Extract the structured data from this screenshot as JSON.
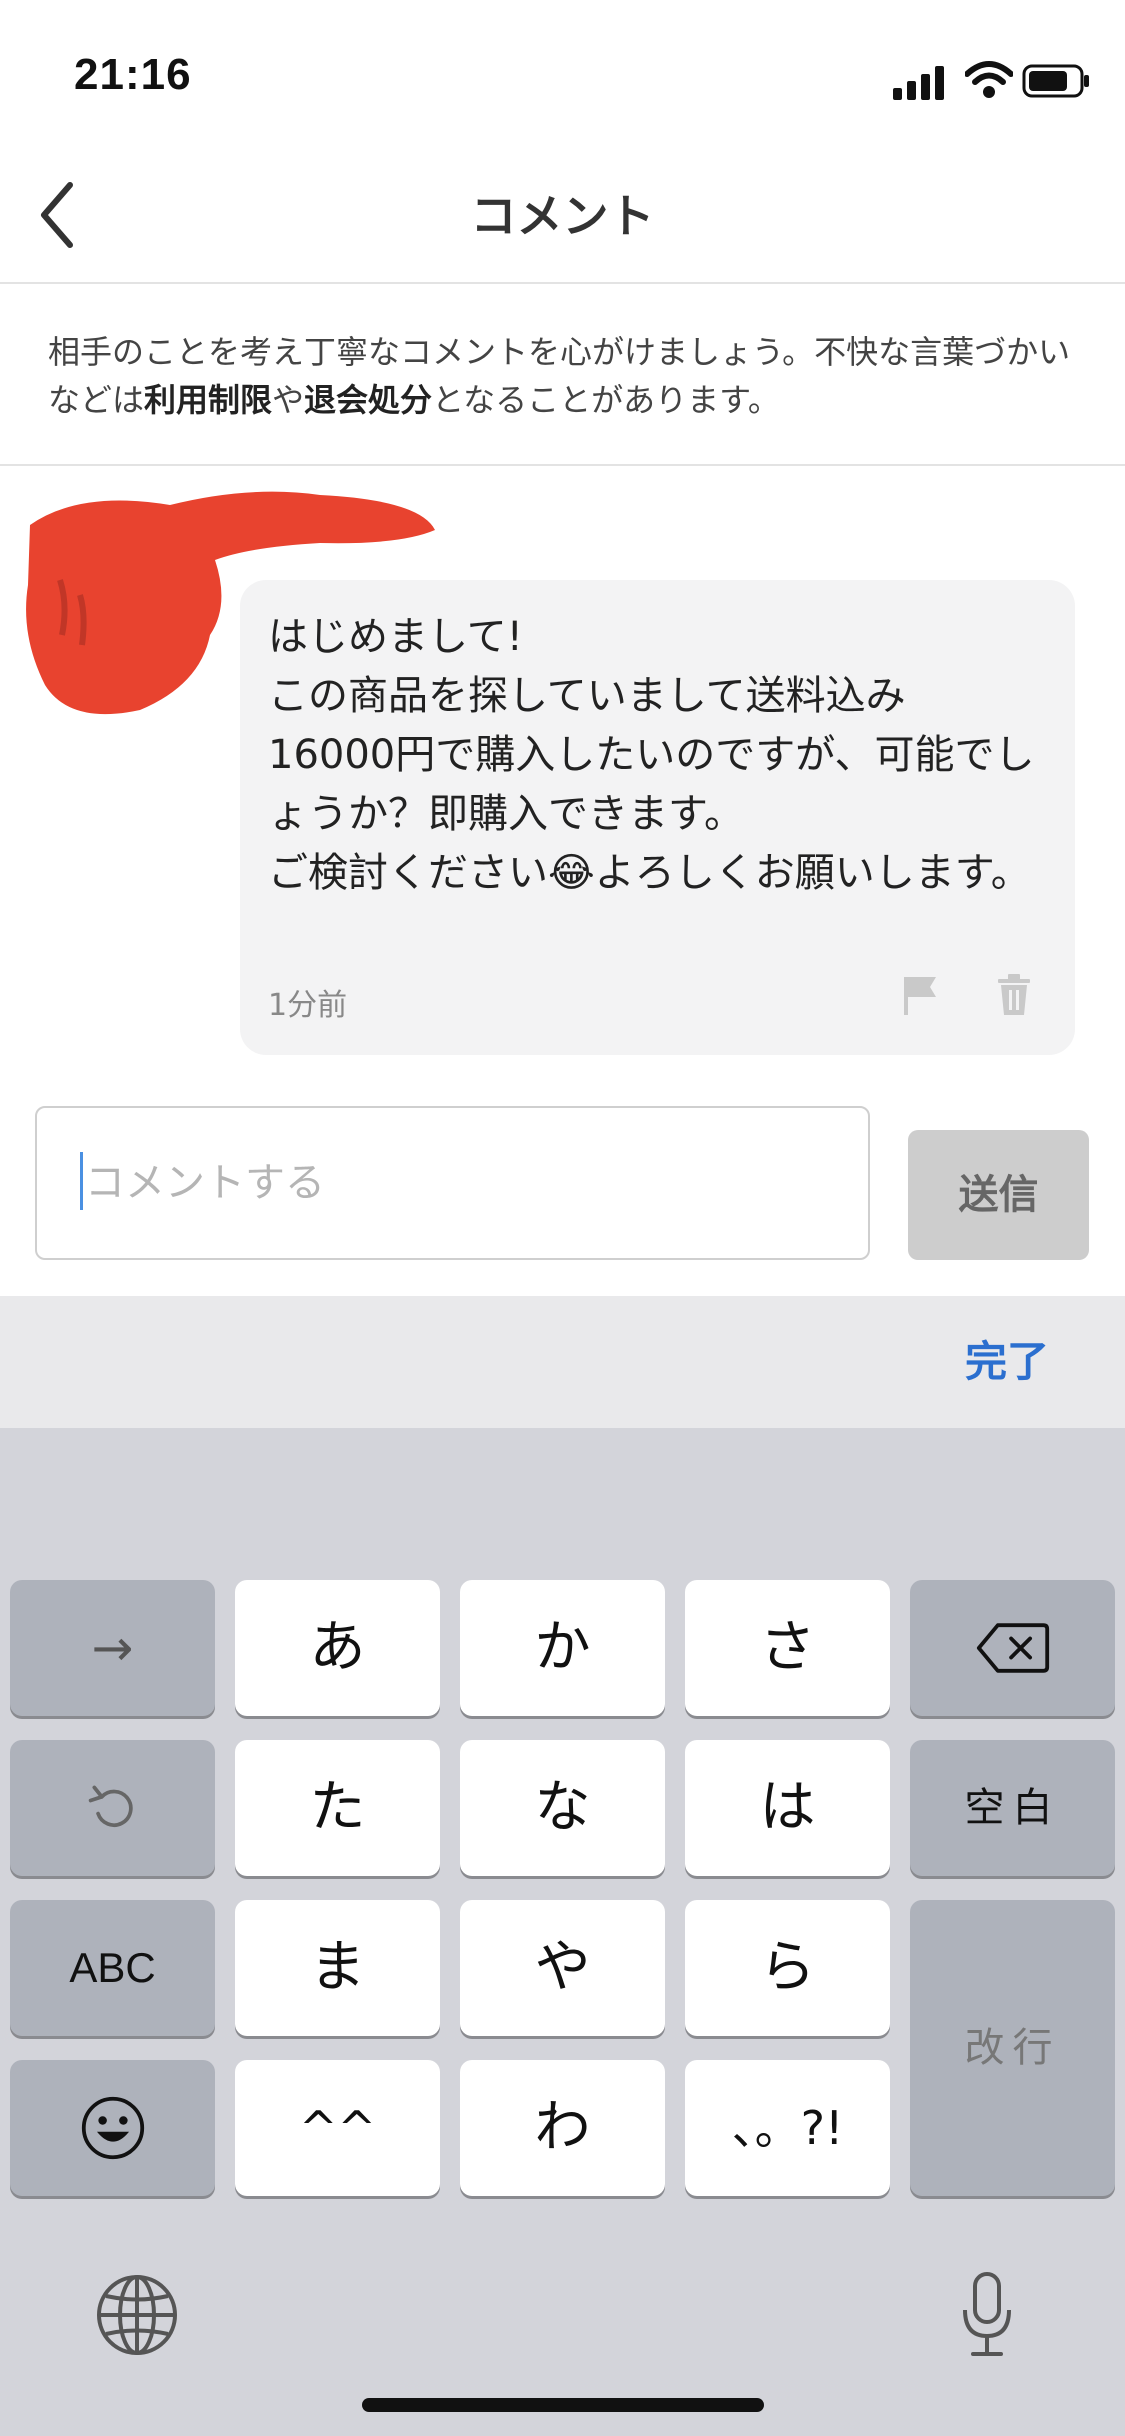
{
  "status_bar": {
    "time": "21:16"
  },
  "nav": {
    "title": "コメント",
    "back_icon": "chevron-left-icon"
  },
  "notice": {
    "text_before": "相手のことを考え丁寧なコメントを心がけましょう。不快な言葉づかいなどは",
    "bold_1": "利用制限",
    "middle": "や",
    "bold_2": "退会処分",
    "text_after": "となることがあります。"
  },
  "comment": {
    "text": "はじめまして!\nこの商品を探していまして送料込み\n16000円で購入したいのですが、可能でしょうか？即購入できます。\nご検討ください😂よろしくお願いします。",
    "time": "1分前",
    "flag_icon": "flag-icon",
    "trash_icon": "trash-icon"
  },
  "input": {
    "placeholder": "コメントする",
    "send_label": "送信"
  },
  "accessory": {
    "done_label": "完了"
  },
  "keyboard": {
    "colors": {
      "light_key": "#ffffff",
      "dark_key": "#aeb2bb",
      "background": "#d3d4da"
    },
    "row1": [
      "→",
      "あ",
      "か",
      "さ",
      "⌫"
    ],
    "row2": [
      "↺",
      "た",
      "な",
      "は",
      "空白"
    ],
    "row3": [
      "ABC",
      "ま",
      "や",
      "ら"
    ],
    "row4": [
      "☺",
      "^^",
      "わ",
      "、。?!"
    ],
    "enter": "改行",
    "globe_icon": "globe-icon",
    "mic_icon": "microphone-icon"
  }
}
